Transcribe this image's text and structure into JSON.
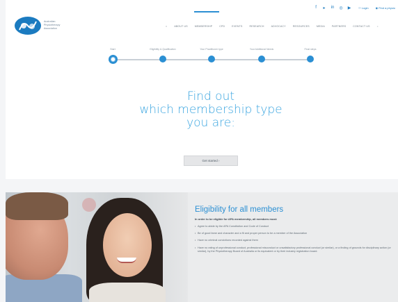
{
  "logo": {
    "line1": "Australian",
    "line2": "Physiotherapy",
    "line3": "Association"
  },
  "utility": {
    "social": [
      {
        "icon": "facebook-icon",
        "glyph": "f"
      },
      {
        "icon": "twitter-icon",
        "glyph": "▸"
      },
      {
        "icon": "linkedin-icon",
        "glyph": "in"
      },
      {
        "icon": "instagram-icon",
        "glyph": "◎"
      },
      {
        "icon": "youtube-icon",
        "glyph": "▶"
      }
    ],
    "login": "Login",
    "find_physio": "Find a physio"
  },
  "nav": {
    "items": [
      "ABOUT US",
      "MEMBERSHIP",
      "CPD",
      "EVENTS",
      "RESEARCH",
      "ADVOCACY",
      "RESOURCES",
      "MEDIA",
      "PARTNERS",
      "CONTACT US"
    ]
  },
  "stepper": {
    "steps": [
      "Start",
      "Eligibility & Qualification",
      "Your Practitioner type",
      "Your Additional Needs",
      "Final steps"
    ],
    "current_index": 0
  },
  "hero": {
    "line1": "Find out",
    "line2": "which membership type",
    "line3": "you are:",
    "cta": "Get started"
  },
  "eligibility": {
    "heading": "Eligibility for all members",
    "intro": "In order to be eligible for APA membership, all members must:",
    "items": [
      "Agree to abide by the APA Constitution and Code of Conduct",
      "Be of good fame and character and a fit and proper person to be a member of the Association",
      "Have no criminal convictions recorded against them",
      "Have no rating of unprofessional conduct, professional misconduct or unsatisfactory professional conduct (or similar), or a finding of grounds for disciplinary action (or similar), by the Physiotherapy Board of Australia or its equivalent or by their industry registration board."
    ]
  },
  "colors": {
    "brand_blue": "#2b8fd3",
    "headline_blue": "#3aa5e0"
  }
}
